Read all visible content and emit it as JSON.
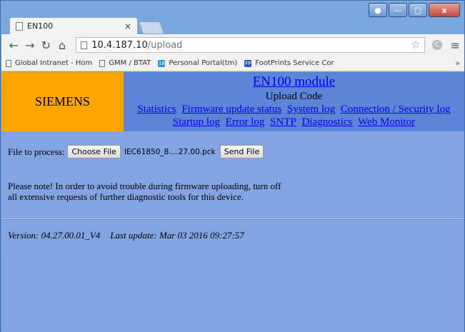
{
  "browser": {
    "tab_title": "EN100",
    "tab_close": "×",
    "url_host": "10.4.187.10",
    "url_path": "/upload",
    "bookmarks": [
      {
        "label": "Global Intranet - Hom",
        "icon": "page-icon"
      },
      {
        "label": "GMM / BTAT",
        "icon": "page-icon"
      },
      {
        "label": "Personal Portal(tm)",
        "icon": "portal-icon",
        "color": "#2d8fdc"
      },
      {
        "label": "FootPrints Service Cor",
        "icon": "footprints-icon",
        "color": "#2a56b8"
      }
    ],
    "bookmarks_overflow": "»"
  },
  "page": {
    "logo": "SIEMENS",
    "title": "EN100 module",
    "subtitle": "Upload Code",
    "links_row1": [
      "Statistics",
      "Firmware update status",
      "System log",
      "Connection / Security log"
    ],
    "links_row2": [
      "Startup log",
      "Error log",
      "SNTP",
      "Diagnostics",
      "Web Monitor"
    ],
    "form": {
      "label": "File to process:",
      "choose_button": "Choose File",
      "file_name": "IEC61850_8....27.00.pck",
      "send_button": "Send File"
    },
    "note_line1": "Please note! In order to avoid trouble during firmware uploading, turn off",
    "note_line2": "all extensive requests of further diagnostic tools for this device.",
    "version": "Version: 04.27.00.01_V4",
    "last_update": "Last update: Mar 03 2016 09:27:57"
  },
  "colors": {
    "logo_bg": "#ffa500",
    "header_bg": "#5c85d8",
    "content_bg": "#84a3e3",
    "link": "#0000ee"
  }
}
